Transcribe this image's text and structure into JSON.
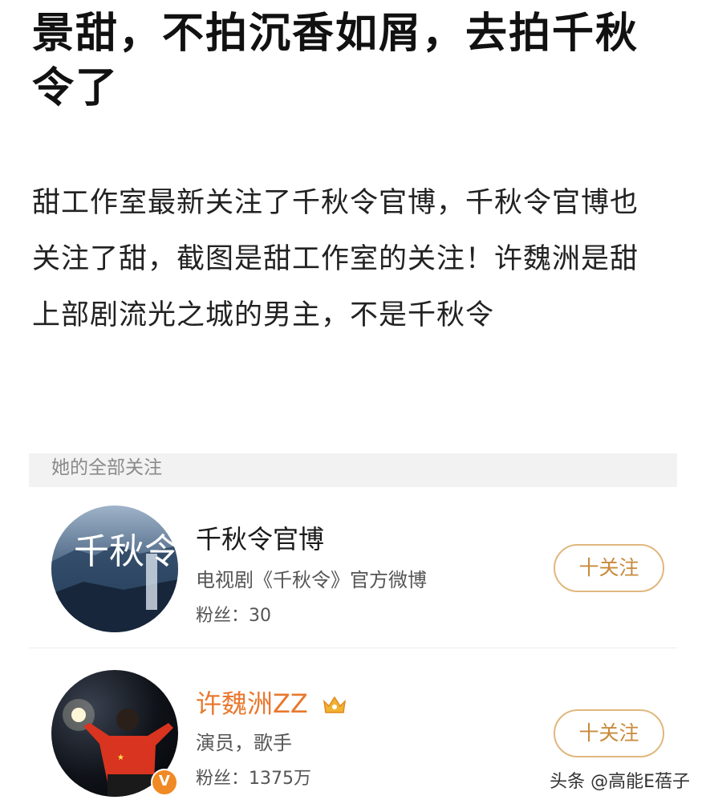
{
  "article": {
    "title": "景甜，不拍沉香如屑，去拍千秋令了",
    "body": "甜工作室最新关注了千秋令官博，千秋令官博也关注了甜，截图是甜工作室的关注！许魏洲是甜上部剧流光之城的男主，不是千秋令"
  },
  "follow_list": {
    "header": "她的全部关注",
    "items": [
      {
        "name": "千秋令官博",
        "description": "电视剧《千秋令》官方微博",
        "fans": "粉丝：30",
        "button": "十关注",
        "avatar_text": "千秋令"
      },
      {
        "name": "许魏洲ZZ",
        "description": "演员，歌手",
        "fans": "粉丝：1375万",
        "button": "十关注",
        "badge": "V"
      }
    ]
  },
  "watermark": "头条 @高能E蓓子",
  "colors": {
    "accent": "#e8792f",
    "button_border": "#e0b77e",
    "header_bg": "#f2f2f2"
  }
}
